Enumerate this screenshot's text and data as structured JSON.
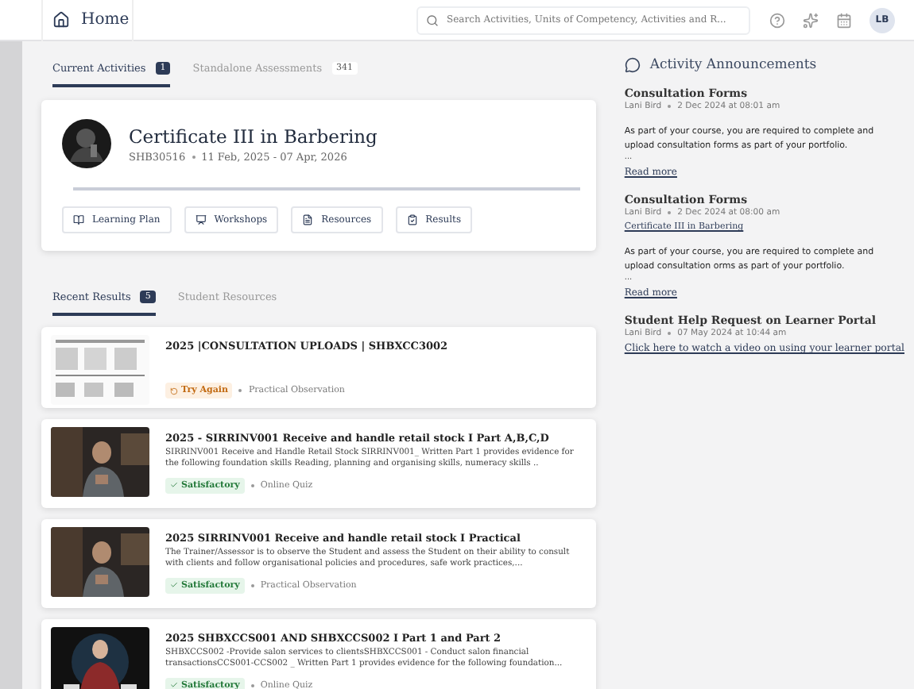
{
  "header": {
    "title": "Home",
    "search": {
      "placeholder": "Search Activities, Units of Competency, Activities and R..."
    },
    "avatar": "LB"
  },
  "main_tabs": [
    {
      "label": "Current Activities",
      "count": "1",
      "selected": true
    },
    {
      "label": "Standalone Assessments",
      "count": "341",
      "selected": false
    }
  ],
  "course": {
    "title": "Certificate III in Barbering",
    "code": "SHB30516",
    "dates": "11 Feb, 2025 - 07 Apr, 2026",
    "progress": {
      "level": 1
    },
    "buttons": [
      {
        "label": "Learning Plan",
        "kind": "plan"
      },
      {
        "label": "Workshops",
        "kind": "workshop"
      },
      {
        "label": "Resources",
        "kind": "resource"
      },
      {
        "label": "Results",
        "kind": "result"
      }
    ]
  },
  "results_tabs": [
    {
      "label": "Recent Results",
      "count": "5",
      "selected": true
    },
    {
      "label": "Student Resources",
      "selected": false
    }
  ],
  "results": [
    {
      "title": "2025 |CONSULTATION UPLOADS | SHBXCC3002",
      "status": "Try Again",
      "kind": "retry",
      "type": "Practical Observation"
    },
    {
      "title": "2025 - SIRRINV001 Receive and handle retail stock I Part A,B,C,D",
      "description": "SIRRINV001 Receive and Handle Retail Stock SIRRINV001_ Written Part 1 provides evidence for the following foundation skills Reading, planning and organising skills, numeracy skills ..",
      "status": "Satisfactory",
      "kind": "pass",
      "type": "Online Quiz"
    },
    {
      "title": "2025 SIRRINV001 Receive and handle retail stock I Practical",
      "description": "The Trainer/Assessor is to observe the Student and assess the Student on their ability to consult with clients and follow organisational policies and procedures, safe work practices,...",
      "status": "Satisfactory",
      "kind": "pass",
      "type": "Practical Observation"
    },
    {
      "title": "2025 SHBXCCS001 AND SHBXCCS002 I Part 1 and Part 2",
      "description": "SHBXCCS002 -Provide salon services to clientsSHBXCCS001 - Conduct salon financial transactionsCCS001-CCS002 _ Written Part 1 provides evidence for the following foundation...",
      "status": "Satisfactory",
      "kind": "pass",
      "type": "Online Quiz"
    }
  ],
  "announcements": {
    "title": "Activity Announcements",
    "items": [
      {
        "title": "Consultation Forms",
        "author": "Lani Bird",
        "date": "2 Dec 2024 at 08:01 am",
        "body": "As part of your course, you are required to complete and upload consultation forms as part of your portfolio.",
        "ellipsis": "...",
        "link": "Read more"
      },
      {
        "title": "Consultation Forms",
        "author": "Lani Bird",
        "date": "2 Dec 2024 at 08:00 am",
        "course": "Certificate III in Barbering",
        "body": "As part of your course, you are required to complete and upload consultation orms as part of your portfolio.",
        "ellipsis": "...",
        "link": "Read more"
      },
      {
        "title": "Student Help Request on Learner Portal",
        "author": "Lani Bird",
        "date": "07 May 2024 at 10:44 am",
        "link": "Click here to watch a video on using your learner portal"
      }
    ]
  }
}
